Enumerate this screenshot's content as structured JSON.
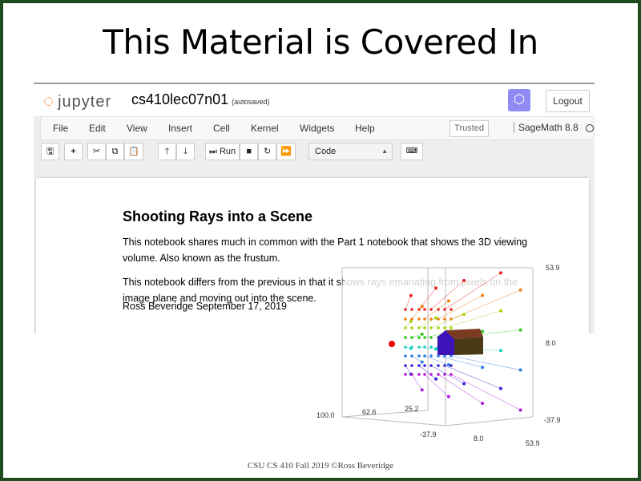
{
  "slide": {
    "title": "This Material is Covered In",
    "footer": "CSU CS 410 Fall 2019 ©Ross Beveridge",
    "border_color": "#1f4a1c"
  },
  "jupyter": {
    "logo": "jupyter",
    "notebook_name": "cs410lec07n01",
    "save_status": "(autosaved)",
    "logout": "Logout",
    "menu": [
      "File",
      "Edit",
      "View",
      "Insert",
      "Cell",
      "Kernel",
      "Widgets",
      "Help"
    ],
    "trusted": "Trusted",
    "kernel": "SageMath 8.8",
    "toolbar": {
      "run": "Run",
      "cell_type": "Code"
    }
  },
  "notebook": {
    "heading": "Shooting Rays into a Scene",
    "p1": "This notebook shares much in common with the Part 1 notebook that shows the 3D viewing volume. Also known as the frustum.",
    "p2": "This notebook differs from the previous in that it shows rays emanating from pixels on the image plane and moving out into the scene.",
    "p3": "Ross Beveridge September 17, 2019"
  },
  "plot3d": {
    "ticks": {
      "z_top": "53.9",
      "z_mid": "8.0",
      "z_bot": "-37.9",
      "x_100": "100.0",
      "x_62": "62.6",
      "x_25": "25.2",
      "y_m37": "-37.9",
      "y_8": "8.0",
      "y_53": "53.9"
    },
    "row_colors": [
      "#e8261e",
      "#f07b12",
      "#a6d40e",
      "#2ec81e",
      "#1ed2c0",
      "#2f7de6",
      "#3a22d8",
      "#b01ad8"
    ]
  }
}
